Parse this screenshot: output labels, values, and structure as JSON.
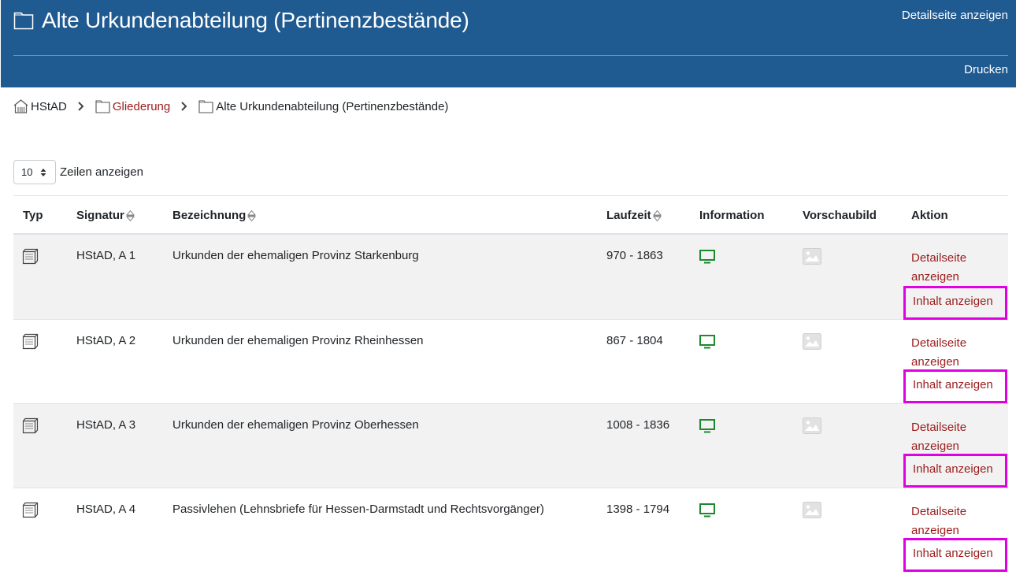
{
  "header": {
    "title": "Alte Urkundenabteilung (Pertinenzbestände)",
    "detail_link": "Detailseite anzeigen",
    "print_link": "Drucken",
    "bg_color": "#1f5a91"
  },
  "breadcrumb": {
    "items": [
      {
        "label": "HStAD",
        "icon": "building-icon"
      },
      {
        "label": "Gliederung",
        "icon": "folder-icon"
      },
      {
        "label": "Alte Urkundenabteilung (Pertinenzbestände)",
        "icon": "folder-icon"
      }
    ]
  },
  "length_control": {
    "value": "10",
    "label": "Zeilen anzeigen"
  },
  "table": {
    "columns": [
      "Typ",
      "Signatur",
      "Bezeichnung",
      "Laufzeit",
      "Information",
      "Vorschaubild",
      "Aktion"
    ],
    "rows": [
      {
        "signatur": "HStAD, A 1",
        "bezeichnung": "Urkunden der ehemaligen Provinz Starkenburg",
        "laufzeit": "970 - 1863",
        "action1_line1": "Detailseite",
        "action1_line2": "anzeigen",
        "action2": "Inhalt anzeigen"
      },
      {
        "signatur": "HStAD, A 2",
        "bezeichnung": "Urkunden der ehemaligen Provinz Rheinhessen",
        "laufzeit": "867 - 1804",
        "action1_line1": "Detailseite",
        "action1_line2": "anzeigen",
        "action2": "Inhalt anzeigen"
      },
      {
        "signatur": "HStAD, A 3",
        "bezeichnung": "Urkunden der ehemaligen Provinz Oberhessen",
        "laufzeit": "1008 - 1836",
        "action1_line1": "Detailseite",
        "action1_line2": "anzeigen",
        "action2": "Inhalt anzeigen"
      },
      {
        "signatur": "HStAD, A 4",
        "bezeichnung": "Passivlehen (Lehnsbriefe für Hessen-Darmstadt und Rechtsvorgänger)",
        "laufzeit": "1398 - 1794",
        "action1_line1": "Detailseite",
        "action1_line2": "anzeigen",
        "action2": "Inhalt anzeigen"
      }
    ]
  },
  "colors": {
    "link": "#9b1c1c",
    "info_icon": "#1a8a2e",
    "highlight": "#e100e1",
    "row_stripe": "#f2f2f2"
  }
}
